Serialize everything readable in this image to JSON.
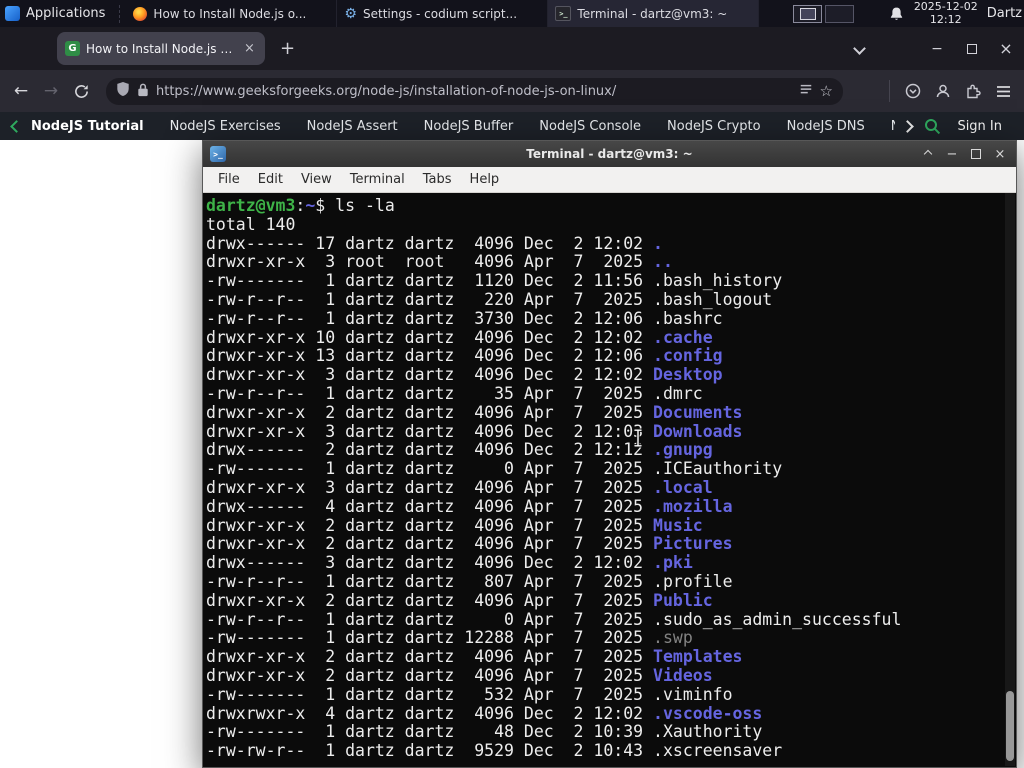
{
  "colors": {
    "term-green": "#3eb348",
    "term-blue": "#6565e0",
    "term-dim": "#828282",
    "term-fg": "#ededed",
    "gfg-green": "#2fa95e"
  },
  "icons": {
    "back": "←",
    "forward": "→",
    "star": "☆",
    "plus": "+",
    "minimize": "−",
    "close": "×",
    "gear": "⚙",
    "terminal_glyph": ">_",
    "favicon_letter": "G"
  },
  "panel": {
    "applications_label": "Applications",
    "windows": [
      {
        "icon": "firefox",
        "title": "How to Install Node.js o...",
        "active": false
      },
      {
        "icon": "gear",
        "title": "Settings - codium script...",
        "active": false
      },
      {
        "icon": "terminal",
        "title": "Terminal - dartz@vm3: ~",
        "active": true
      }
    ],
    "clock_date": "2025-12-02",
    "clock_time": "12:12",
    "user_label": "Dartz"
  },
  "browser": {
    "tab": {
      "title": "How to Install Node.js on..."
    },
    "url": "https://www.geeksforgeeks.org/node-js/installation-of-node-js-on-linux/",
    "gfg": {
      "links": [
        "NodeJS Tutorial",
        "NodeJS Exercises",
        "NodeJS Assert",
        "NodeJS Buffer",
        "NodeJS Console",
        "NodeJS Crypto",
        "NodeJS DNS",
        "Node"
      ],
      "sign_in_label": "Sign In"
    }
  },
  "terminal": {
    "window_title": "Terminal - dartz@vm3: ~",
    "menu_items": [
      "File",
      "Edit",
      "View",
      "Terminal",
      "Tabs",
      "Help"
    ],
    "prompt": {
      "user_host": "dartz@vm3",
      "separator": ":",
      "path": "~",
      "symbol": "$",
      "command": "ls -la"
    },
    "total_line": "total 140",
    "listing": [
      {
        "perms": "drwx------",
        "links": 17,
        "owner": "dartz",
        "group": "dartz",
        "size": 4096,
        "date": "Dec  2 12:02",
        "name": ".",
        "type": "dir"
      },
      {
        "perms": "drwxr-xr-x",
        "links": 3,
        "owner": "root",
        "group": "root",
        "size": 4096,
        "date": "Apr  7  2025",
        "name": "..",
        "type": "dir"
      },
      {
        "perms": "-rw-------",
        "links": 1,
        "owner": "dartz",
        "group": "dartz",
        "size": 1120,
        "date": "Dec  2 11:56",
        "name": ".bash_history",
        "type": "file"
      },
      {
        "perms": "-rw-r--r--",
        "links": 1,
        "owner": "dartz",
        "group": "dartz",
        "size": 220,
        "date": "Apr  7  2025",
        "name": ".bash_logout",
        "type": "file"
      },
      {
        "perms": "-rw-r--r--",
        "links": 1,
        "owner": "dartz",
        "group": "dartz",
        "size": 3730,
        "date": "Dec  2 12:06",
        "name": ".bashrc",
        "type": "file"
      },
      {
        "perms": "drwxr-xr-x",
        "links": 10,
        "owner": "dartz",
        "group": "dartz",
        "size": 4096,
        "date": "Dec  2 12:02",
        "name": ".cache",
        "type": "dir"
      },
      {
        "perms": "drwxr-xr-x",
        "links": 13,
        "owner": "dartz",
        "group": "dartz",
        "size": 4096,
        "date": "Dec  2 12:06",
        "name": ".config",
        "type": "dir"
      },
      {
        "perms": "drwxr-xr-x",
        "links": 3,
        "owner": "dartz",
        "group": "dartz",
        "size": 4096,
        "date": "Dec  2 12:02",
        "name": "Desktop",
        "type": "dir"
      },
      {
        "perms": "-rw-r--r--",
        "links": 1,
        "owner": "dartz",
        "group": "dartz",
        "size": 35,
        "date": "Apr  7  2025",
        "name": ".dmrc",
        "type": "file"
      },
      {
        "perms": "drwxr-xr-x",
        "links": 2,
        "owner": "dartz",
        "group": "dartz",
        "size": 4096,
        "date": "Apr  7  2025",
        "name": "Documents",
        "type": "dir"
      },
      {
        "perms": "drwxr-xr-x",
        "links": 3,
        "owner": "dartz",
        "group": "dartz",
        "size": 4096,
        "date": "Dec  2 12:03",
        "name": "Downloads",
        "type": "dir"
      },
      {
        "perms": "drwx------",
        "links": 2,
        "owner": "dartz",
        "group": "dartz",
        "size": 4096,
        "date": "Dec  2 12:12",
        "name": ".gnupg",
        "type": "dir"
      },
      {
        "perms": "-rw-------",
        "links": 1,
        "owner": "dartz",
        "group": "dartz",
        "size": 0,
        "date": "Apr  7  2025",
        "name": ".ICEauthority",
        "type": "file"
      },
      {
        "perms": "drwxr-xr-x",
        "links": 3,
        "owner": "dartz",
        "group": "dartz",
        "size": 4096,
        "date": "Apr  7  2025",
        "name": ".local",
        "type": "dir"
      },
      {
        "perms": "drwx------",
        "links": 4,
        "owner": "dartz",
        "group": "dartz",
        "size": 4096,
        "date": "Apr  7  2025",
        "name": ".mozilla",
        "type": "dir"
      },
      {
        "perms": "drwxr-xr-x",
        "links": 2,
        "owner": "dartz",
        "group": "dartz",
        "size": 4096,
        "date": "Apr  7  2025",
        "name": "Music",
        "type": "dir"
      },
      {
        "perms": "drwxr-xr-x",
        "links": 2,
        "owner": "dartz",
        "group": "dartz",
        "size": 4096,
        "date": "Apr  7  2025",
        "name": "Pictures",
        "type": "dir"
      },
      {
        "perms": "drwx------",
        "links": 3,
        "owner": "dartz",
        "group": "dartz",
        "size": 4096,
        "date": "Dec  2 12:02",
        "name": ".pki",
        "type": "dir"
      },
      {
        "perms": "-rw-r--r--",
        "links": 1,
        "owner": "dartz",
        "group": "dartz",
        "size": 807,
        "date": "Apr  7  2025",
        "name": ".profile",
        "type": "file"
      },
      {
        "perms": "drwxr-xr-x",
        "links": 2,
        "owner": "dartz",
        "group": "dartz",
        "size": 4096,
        "date": "Apr  7  2025",
        "name": "Public",
        "type": "dir"
      },
      {
        "perms": "-rw-r--r--",
        "links": 1,
        "owner": "dartz",
        "group": "dartz",
        "size": 0,
        "date": "Apr  7  2025",
        "name": ".sudo_as_admin_successful",
        "type": "file"
      },
      {
        "perms": "-rw-------",
        "links": 1,
        "owner": "dartz",
        "group": "dartz",
        "size": 12288,
        "date": "Apr  7  2025",
        "name": ".swp",
        "type": "dim"
      },
      {
        "perms": "drwxr-xr-x",
        "links": 2,
        "owner": "dartz",
        "group": "dartz",
        "size": 4096,
        "date": "Apr  7  2025",
        "name": "Templates",
        "type": "dir"
      },
      {
        "perms": "drwxr-xr-x",
        "links": 2,
        "owner": "dartz",
        "group": "dartz",
        "size": 4096,
        "date": "Apr  7  2025",
        "name": "Videos",
        "type": "dir"
      },
      {
        "perms": "-rw-------",
        "links": 1,
        "owner": "dartz",
        "group": "dartz",
        "size": 532,
        "date": "Apr  7  2025",
        "name": ".viminfo",
        "type": "file"
      },
      {
        "perms": "drwxrwxr-x",
        "links": 4,
        "owner": "dartz",
        "group": "dartz",
        "size": 4096,
        "date": "Dec  2 12:02",
        "name": ".vscode-oss",
        "type": "dir"
      },
      {
        "perms": "-rw-------",
        "links": 1,
        "owner": "dartz",
        "group": "dartz",
        "size": 48,
        "date": "Dec  2 10:39",
        "name": ".Xauthority",
        "type": "file"
      },
      {
        "perms": "-rw-rw-r--",
        "links": 1,
        "owner": "dartz",
        "group": "dartz",
        "size": 9529,
        "date": "Dec  2 10:43",
        "name": ".xscreensaver",
        "type": "file"
      }
    ]
  }
}
